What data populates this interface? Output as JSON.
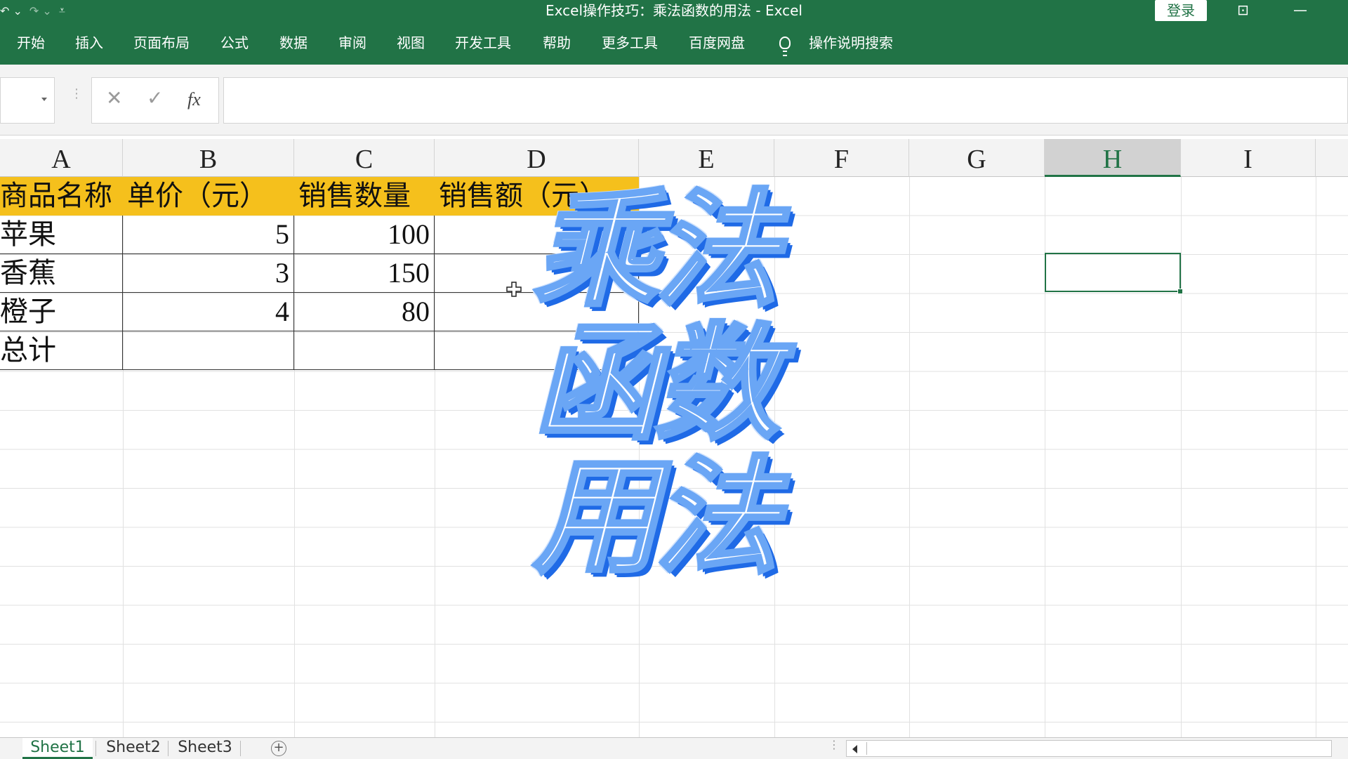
{
  "window": {
    "title": "Excel操作技巧：乘法函数的用法 - Excel",
    "login_label": "登录"
  },
  "ribbon": {
    "tabs": [
      "开始",
      "插入",
      "页面布局",
      "公式",
      "数据",
      "审阅",
      "视图",
      "开发工具",
      "帮助",
      "更多工具",
      "百度网盘"
    ],
    "search_label": "操作说明搜索"
  },
  "formula_bar": {
    "name_box": "",
    "fx_label": "fx",
    "formula": ""
  },
  "columns": [
    "A",
    "B",
    "C",
    "D",
    "E",
    "F",
    "G",
    "H",
    "I"
  ],
  "selected_column": "H",
  "table": {
    "headers": [
      "商品名称",
      "单价（元）",
      "销售数量",
      "销售额（元）"
    ],
    "rows": [
      {
        "name": "苹果",
        "price": "5",
        "qty": "100",
        "sales": ""
      },
      {
        "name": "香蕉",
        "price": "3",
        "qty": "150",
        "sales": ""
      },
      {
        "name": "橙子",
        "price": "4",
        "qty": "80",
        "sales": ""
      },
      {
        "name": "总计",
        "price": "",
        "qty": "",
        "sales": ""
      }
    ]
  },
  "overlay": {
    "lines": [
      "乘法",
      "函数",
      "用法"
    ],
    "fill_color": "#ffffff",
    "shadow_color": "#1f6ae6"
  },
  "sheets": {
    "tabs": [
      "Sheet1",
      "Sheet2",
      "Sheet3"
    ],
    "active": "Sheet1"
  },
  "colors": {
    "brand": "#217346",
    "header_fill": "#f5c01c"
  }
}
